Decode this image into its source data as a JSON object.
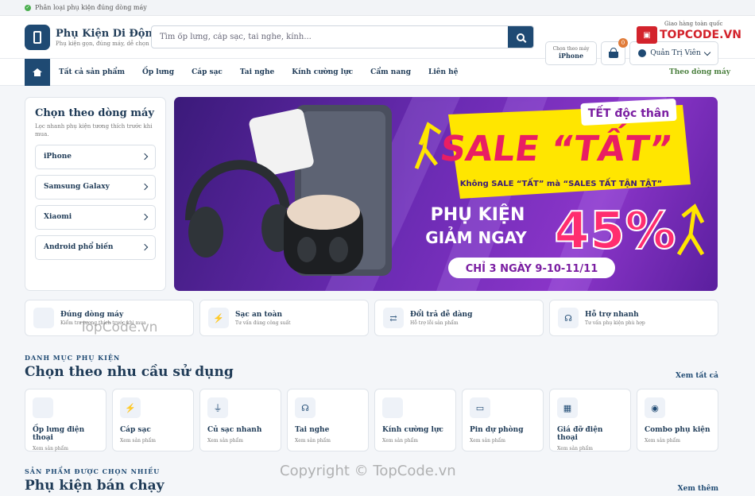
{
  "topbar": {
    "left": "Phân loại phụ kiện đúng dòng máy",
    "right": "Giao hàng toàn quốc"
  },
  "brand": {
    "name": "Phụ Kiện Di Động",
    "slogan": "Phụ kiện gọn, đúng máy, dễ chọn"
  },
  "search": {
    "placeholder": "Tìm ốp lưng, cáp sạc, tai nghe, kính..."
  },
  "device_picker": {
    "label": "Chọn theo máy",
    "value": "iPhone"
  },
  "cart": {
    "count": "0"
  },
  "account": {
    "label": "Quản Trị Viên"
  },
  "watermark_logo": {
    "text": "TOPCODE.VN"
  },
  "nav": {
    "items": [
      "Tất cả sản phẩm",
      "Ốp lưng",
      "Cáp sạc",
      "Tai nghe",
      "Kính cường lực",
      "Cẩm nang",
      "Liên hệ"
    ],
    "right": "Theo dòng máy"
  },
  "sidebar": {
    "title": "Chọn theo dòng máy",
    "desc": "Lọc nhanh phụ kiện tương thích trước khi mua.",
    "items": [
      "iPhone",
      "Samsung Galaxy",
      "Xiaomi",
      "Android phổ biến"
    ]
  },
  "banner": {
    "tag": "TẾT độc thân",
    "headline": "SALE “TẤT”",
    "sub": "Không SALE “TẤT” mà “SALES TẤT TẬN TẬT”",
    "line1": "PHỤ KIỆN",
    "line2": "GIẢM NGAY",
    "percent": "45%",
    "dates": "CHỈ 3 NGÀY 9-10-11/11"
  },
  "features": [
    {
      "title": "Đúng dòng máy",
      "desc": "Kiểm tra tương thích trước khi mua",
      "icon": "device-icon",
      "glyph": ""
    },
    {
      "title": "Sạc an toàn",
      "desc": "Tư vấn đúng công suất",
      "icon": "bolt-icon",
      "glyph": "⚡"
    },
    {
      "title": "Đổi trả dễ dàng",
      "desc": "Hỗ trợ lỗi sản phẩm",
      "icon": "refresh-icon",
      "glyph": "⇄"
    },
    {
      "title": "Hỗ trợ nhanh",
      "desc": "Tư vấn phụ kiện phù hợp",
      "icon": "headset-icon",
      "glyph": "☊"
    }
  ],
  "categories_section": {
    "label": "DANH MỤC PHỤ KIỆN",
    "title": "Chọn theo nhu cầu sử dụng",
    "link": "Xem tất cả"
  },
  "categories": [
    {
      "title": "Ốp lưng điện thoại",
      "desc": "Xem sản phẩm",
      "icon": "case-icon",
      "glyph": ""
    },
    {
      "title": "Cáp sạc",
      "desc": "Xem sản phẩm",
      "icon": "bolt-icon",
      "glyph": "⚡"
    },
    {
      "title": "Củ sạc nhanh",
      "desc": "Xem sản phẩm",
      "icon": "plug-icon",
      "glyph": "⏚"
    },
    {
      "title": "Tai nghe",
      "desc": "Xem sản phẩm",
      "icon": "headphones-icon",
      "glyph": "☊"
    },
    {
      "title": "Kính cường lực",
      "desc": "Xem sản phẩm",
      "icon": "glass-icon",
      "glyph": ""
    },
    {
      "title": "Pin dự phòng",
      "desc": "Xem sản phẩm",
      "icon": "battery-icon",
      "glyph": "▭"
    },
    {
      "title": "Giá đỡ điện thoại",
      "desc": "Xem sản phẩm",
      "icon": "grid-icon",
      "glyph": "▦"
    },
    {
      "title": "Combo phụ kiện",
      "desc": "Xem sản phẩm",
      "icon": "combo-icon",
      "glyph": "◉"
    }
  ],
  "bestseller_section": {
    "label": "SẢN PHẨM ĐƯỢC CHỌN NHIỀU",
    "title": "Phụ kiện bán chạy",
    "link": "Xem thêm"
  },
  "watermarks": {
    "center": "TopCode.vn",
    "copyright": "Copyright © TopCode.vn"
  },
  "colors": {
    "primary": "#1f4a73",
    "accent": "#e07b39",
    "brand_red": "#d3232c",
    "banner_purple": "#6b2bb3"
  }
}
